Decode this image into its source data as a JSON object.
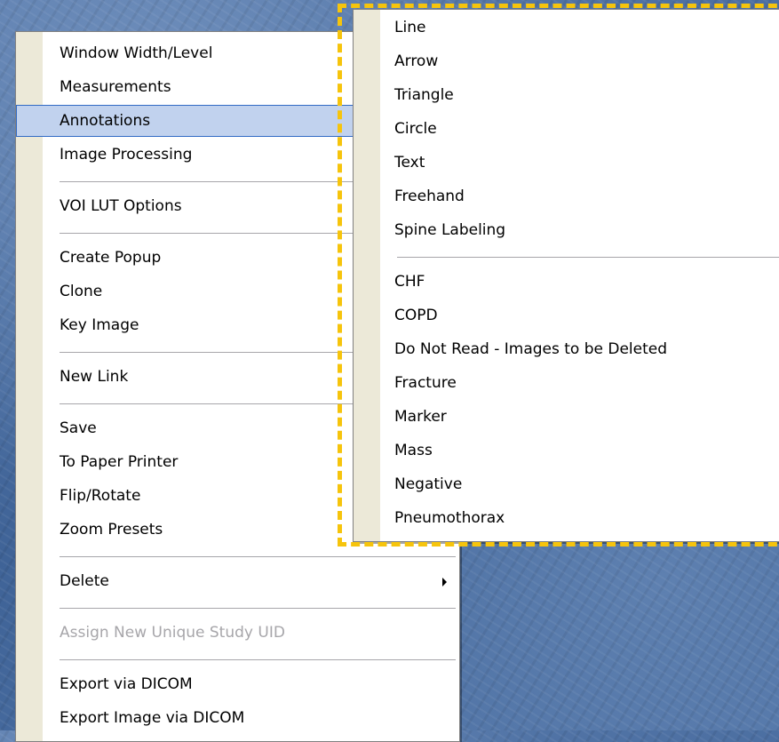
{
  "context_menu": {
    "items": [
      {
        "label": "Window Width/Level"
      },
      {
        "label": "Measurements"
      },
      {
        "label": "Annotations"
      },
      {
        "label": "Image Processing"
      },
      {
        "label": "VOI LUT Options"
      },
      {
        "label": "Create Popup"
      },
      {
        "label": "Clone"
      },
      {
        "label": "Key Image"
      },
      {
        "label": "New Link"
      },
      {
        "label": "Save"
      },
      {
        "label": "To Paper Printer"
      },
      {
        "label": "Flip/Rotate"
      },
      {
        "label": "Zoom Presets"
      },
      {
        "label": "Delete"
      },
      {
        "label": "Assign New Unique Study UID"
      },
      {
        "label": "Export via DICOM"
      },
      {
        "label": "Export Image via DICOM"
      }
    ]
  },
  "annotations_submenu": {
    "items": [
      {
        "label": "Line"
      },
      {
        "label": "Arrow"
      },
      {
        "label": "Triangle"
      },
      {
        "label": "Circle"
      },
      {
        "label": "Text"
      },
      {
        "label": "Freehand"
      },
      {
        "label": "Spine Labeling"
      },
      {
        "label": "CHF"
      },
      {
        "label": "COPD"
      },
      {
        "label": "Do Not Read - Images to be Deleted"
      },
      {
        "label": "Fracture"
      },
      {
        "label": "Marker"
      },
      {
        "label": "Mass"
      },
      {
        "label": "Negative"
      },
      {
        "label": "Pneumothorax"
      }
    ]
  },
  "icons": {
    "submenu_arrow": "chevron-right-icon"
  },
  "colors": {
    "highlight_fill": "#c1d2ee",
    "highlight_border": "#316ac5",
    "focus_outline": "#f6c40c",
    "disabled_text": "#a7a6aa"
  }
}
